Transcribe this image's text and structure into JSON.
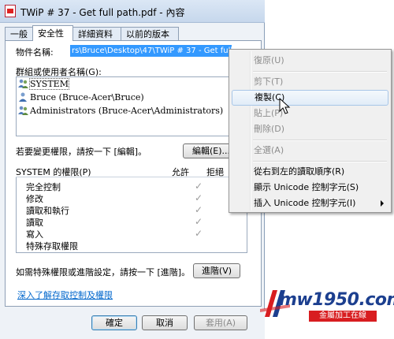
{
  "window": {
    "title": "TWiP # 37 - Get full path.pdf - 內容",
    "tabs": [
      {
        "label": "一般",
        "active": false
      },
      {
        "label": "安全性",
        "active": true
      },
      {
        "label": "詳細資料",
        "active": false
      },
      {
        "label": "以前的版本",
        "active": false
      }
    ]
  },
  "security": {
    "object_name_label": "物件名稱:",
    "object_name_value": "rs\\Bruce\\Desktop\\47\\TWiP # 37 - Get full path.p",
    "groups_label": "群組或使用者名稱(G):",
    "users": [
      {
        "name": "SYSTEM",
        "selected": true
      },
      {
        "name": "Bruce (Bruce-Acer\\Bruce)",
        "selected": false
      },
      {
        "name": "Administrators (Bruce-Acer\\Administrators)",
        "selected": false
      }
    ],
    "change_perm_text": "若要變更權限，請按一下 [編輯]。",
    "edit_button": "編輯(E)...",
    "perm_for_label": "SYSTEM 的權限(P)",
    "allow_header": "允許",
    "deny_header": "拒絕",
    "permissions": [
      {
        "name": "完全控制",
        "allow": true
      },
      {
        "name": "修改",
        "allow": true
      },
      {
        "name": "讀取和執行",
        "allow": true
      },
      {
        "name": "讀取",
        "allow": true
      },
      {
        "name": "寫入",
        "allow": true
      },
      {
        "name": "特殊存取權限",
        "allow": false
      }
    ],
    "advanced_text": "如需特殊權限或進階設定，請按一下 [進階]。",
    "advanced_button": "進階(V)",
    "learn_link": "深入了解存取控制及權限"
  },
  "footer": {
    "ok": "確定",
    "cancel": "取消",
    "apply": "套用(A)"
  },
  "context_menu": {
    "items": [
      {
        "label": "復原(U)",
        "disabled": true
      },
      {
        "label": "剪下(T)",
        "disabled": true
      },
      {
        "label": "複製(C)",
        "disabled": false,
        "hover": true
      },
      {
        "label": "貼上(P)",
        "disabled": true
      },
      {
        "label": "刪除(D)",
        "disabled": true
      },
      {
        "label": "全選(A)",
        "disabled": true
      },
      {
        "label": "從右到左的讀取順序(R)",
        "disabled": false
      },
      {
        "label": "顯示 Unicode 控制字元(S)",
        "disabled": false
      },
      {
        "label": "插入 Unicode 控制字元(I)",
        "disabled": false,
        "submenu": true
      }
    ]
  },
  "watermark": {
    "text": "mw1950.com",
    "subtext": "金屬加工在線"
  },
  "colors": {
    "selection": "#3399ff",
    "link": "#0066cc",
    "menu_hover_border": "#a8c6e8",
    "watermark_blue": "#1c3f8f",
    "watermark_red": "#d81d20"
  }
}
